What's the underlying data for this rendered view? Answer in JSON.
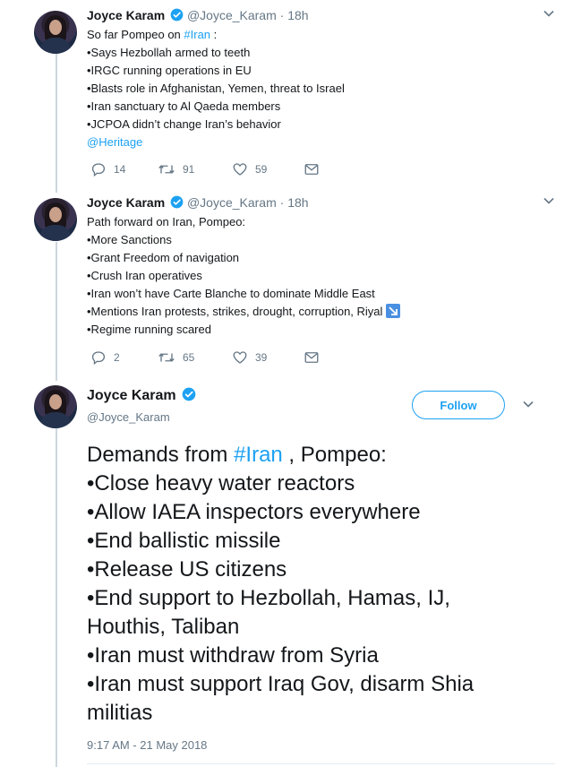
{
  "colors": {
    "link": "#1da1f2",
    "muted": "#657786",
    "text": "#14171a",
    "line": "#ccd6dd"
  },
  "tweets": [
    {
      "name": "Joyce Karam",
      "handle": "@Joyce_Karam",
      "dot": "·",
      "time": "18h",
      "intro_text": "So far Pompeo on ",
      "intro_tag": "#Iran",
      "intro_suffix": " :",
      "lines": [
        "•Says Hezbollah armed to teeth",
        "•IRGC running operations in EU",
        "•Blasts role in Afghanistan, Yemen, threat to Israel",
        "•Iran sanctuary to Al Qaeda members",
        "•JCPOA didn’t change Iran’s behavior"
      ],
      "mention": "@Heritage",
      "replies": "14",
      "retweets": "91",
      "likes": "59"
    },
    {
      "name": "Joyce Karam",
      "handle": "@Joyce_Karam",
      "dot": "·",
      "time": "18h",
      "lines": [
        "Path forward on Iran, Pompeo:",
        "•More Sanctions",
        "•Grant Freedom of navigation",
        "•Crush Iran operatives",
        "•Iran won’t have Carte Blanche to dominate Middle East",
        "•Mentions Iran protests, strikes, drought, corruption, Riyal",
        "•Regime running scared"
      ],
      "replies": "2",
      "retweets": "65",
      "likes": "39"
    }
  ],
  "main_tweet": {
    "name": "Joyce Karam",
    "handle": "@Joyce_Karam",
    "follow_label": "Follow",
    "first_prefix": "Demands from ",
    "first_tag": "#Iran",
    "first_suffix": " , Pompeo:",
    "lines": [
      "•Close heavy water reactors",
      "•Allow IAEA inspectors everywhere",
      "•End ballistic missile",
      "•Release US citizens",
      "•End support to Hezbollah, Hamas, IJ,",
      "Houthis, Taliban",
      "•Iran must withdraw from Syria",
      "•Iran must support Iraq Gov, disarm Shia",
      "militias"
    ],
    "timestamp": "9:17 AM - 21 May 2018"
  }
}
